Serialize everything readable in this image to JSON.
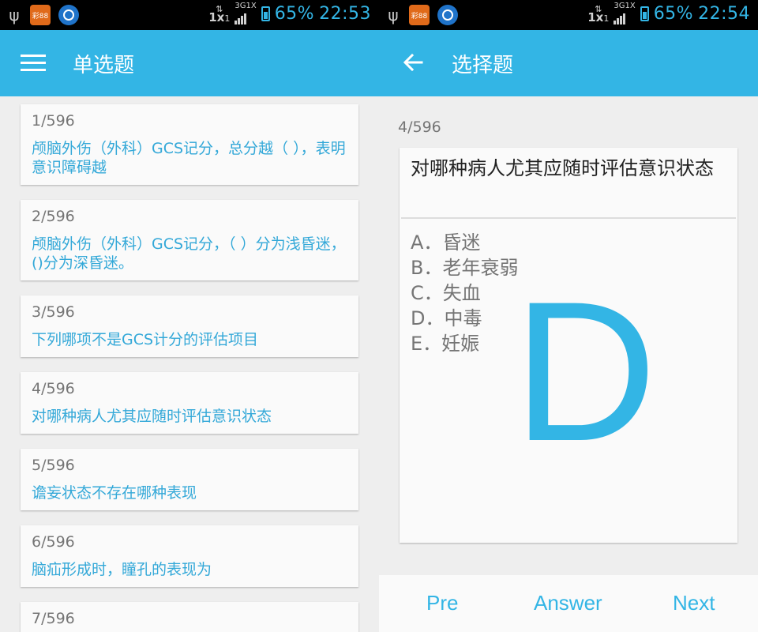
{
  "status_left": {
    "app1_label": "彩88",
    "net": "1x",
    "net_sub": "1",
    "net3g": "3G1X",
    "battery": "65%",
    "time": "22:53"
  },
  "status_right": {
    "app1_label": "彩88",
    "net": "1x",
    "net_sub": "1",
    "net3g": "3G1X",
    "battery": "65%",
    "time": "22:54"
  },
  "left_screen": {
    "title": "单选题",
    "items": [
      {
        "num": "1/596",
        "text": "颅脑外伤（外科）GCS记分，总分越（ ），表明意识障碍越"
      },
      {
        "num": "2/596",
        "text": "颅脑外伤（外科）GCS记分，（ ）分为浅昏迷，()分为深昏迷。"
      },
      {
        "num": "3/596",
        "text": "下列哪项不是GCS计分的评估项目"
      },
      {
        "num": "4/596",
        "text": "对哪种病人尤其应随时评估意识状态"
      },
      {
        "num": "5/596",
        "text": "谵妄状态不存在哪种表现"
      },
      {
        "num": "6/596",
        "text": "脑疝形成时，瞳孔的表现为"
      },
      {
        "num": "7/596",
        "text": ""
      }
    ]
  },
  "right_screen": {
    "title": "选择题",
    "question_num": "4/596",
    "question": "对哪种病人尤其应随时评估意识状态",
    "options": [
      "A．昏迷",
      "B．老年衰弱",
      "C．失血",
      "D．中毒",
      "E．妊娠"
    ],
    "answer": "D",
    "buttons": {
      "pre": "Pre",
      "answer": "Answer",
      "next": "Next"
    }
  },
  "colors": {
    "accent": "#33b5e5",
    "link_text": "#33a8d8"
  }
}
